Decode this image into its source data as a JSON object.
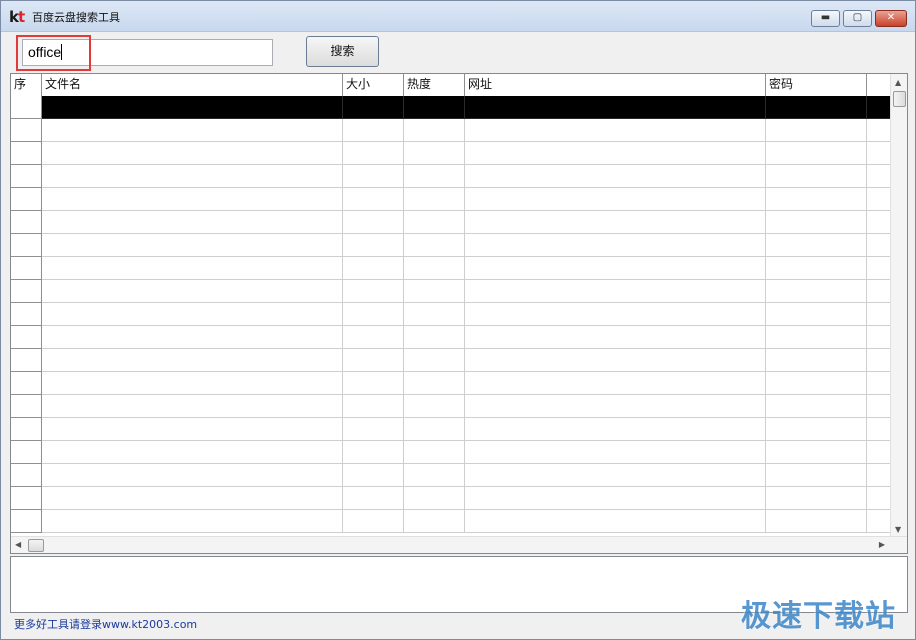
{
  "window": {
    "logo_k": "k",
    "logo_t": "t",
    "title": "百度云盘搜索工具",
    "minimize_glyph": "▬",
    "maximize_glyph": "▢",
    "close_glyph": "✕"
  },
  "search": {
    "value": "office",
    "button_label": "搜索"
  },
  "table": {
    "columns": [
      {
        "label": "序"
      },
      {
        "label": "文件名"
      },
      {
        "label": "大小"
      },
      {
        "label": "热度"
      },
      {
        "label": "网址"
      },
      {
        "label": "密码"
      },
      {
        "label": ""
      }
    ],
    "selected_row": 0,
    "row_count": 19
  },
  "footer": {
    "link_text": "更多好工具请登录www.kt2003.com"
  },
  "watermark": {
    "text": "极速下载站"
  },
  "colors": {
    "highlight": "#e03a3a",
    "selected_row": "#000000",
    "footer_link": "#1a3a9c",
    "watermark": "#3c86c8"
  }
}
